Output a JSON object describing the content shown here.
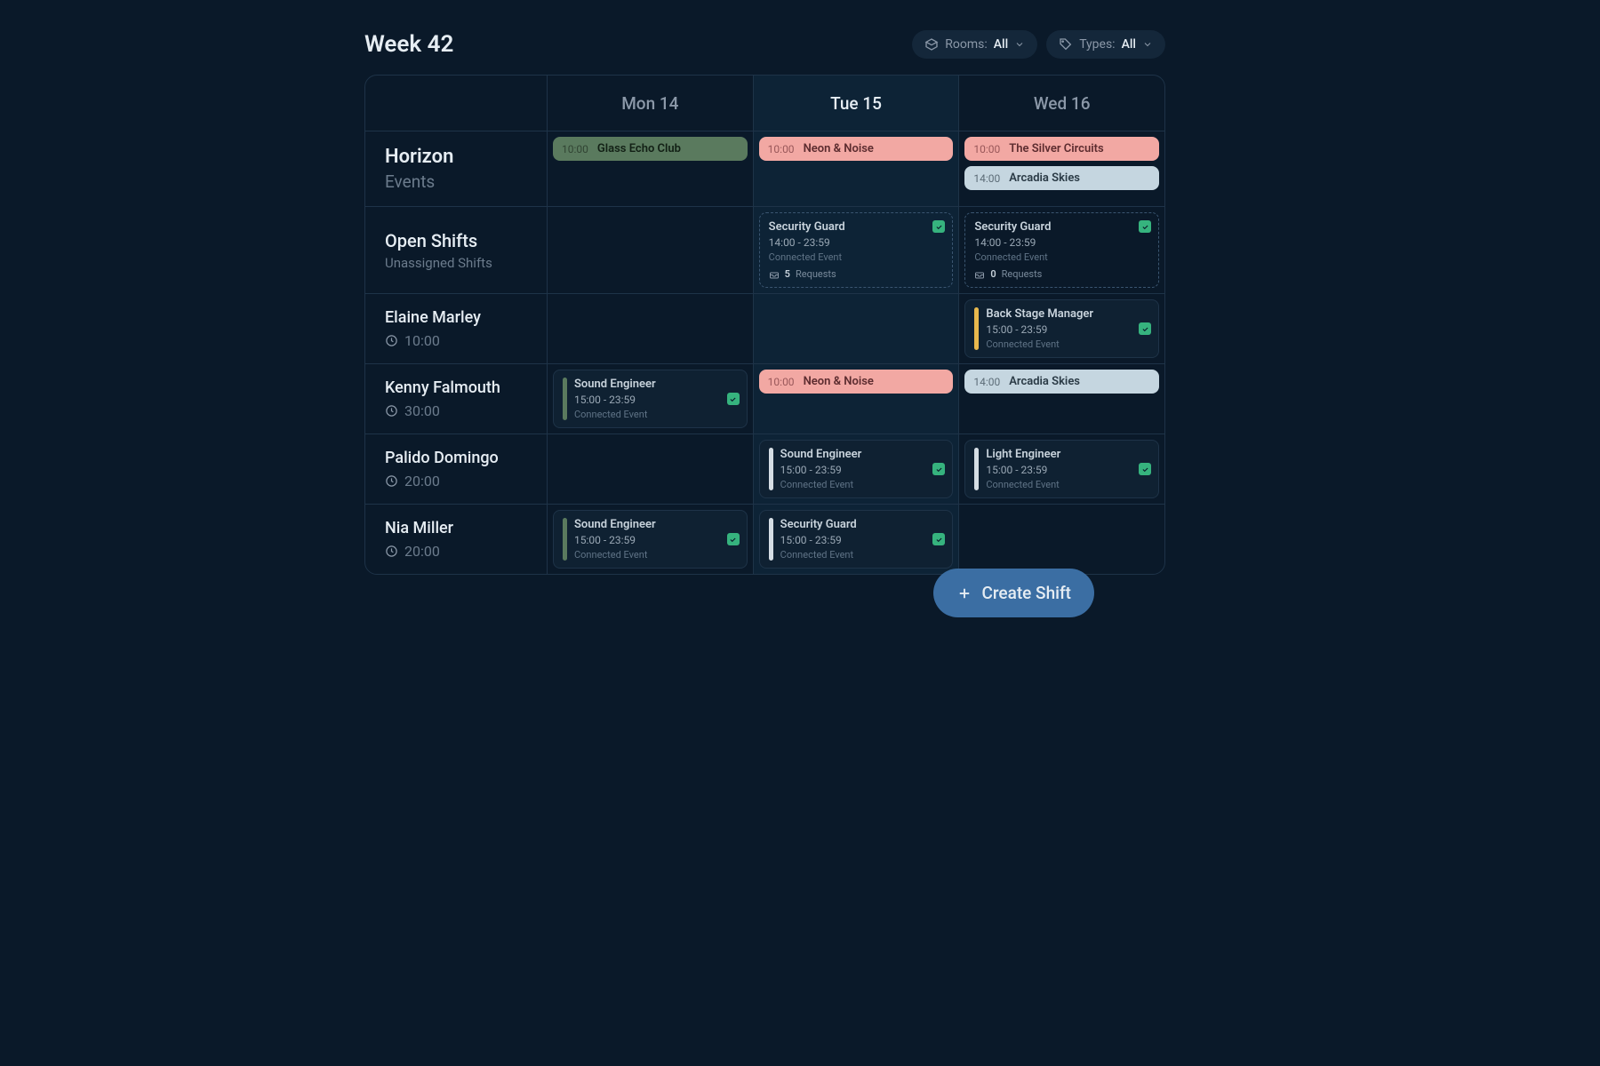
{
  "header": {
    "week_title": "Week 42",
    "rooms_label": "Rooms:",
    "rooms_value": "All",
    "types_label": "Types:",
    "types_value": "All"
  },
  "days": [
    {
      "label": "Mon 14",
      "active": false
    },
    {
      "label": "Tue 15",
      "active": true
    },
    {
      "label": "Wed 16",
      "active": false
    }
  ],
  "rows": [
    {
      "kind": "events",
      "name": "Horizon",
      "sub": "Events",
      "cells": [
        {
          "events": [
            {
              "time": "10:00",
              "name": "Glass Echo Club",
              "color": "green"
            }
          ]
        },
        {
          "events": [
            {
              "time": "10:00",
              "name": "Neon & Noise",
              "color": "pink"
            }
          ]
        },
        {
          "events": [
            {
              "time": "10:00",
              "name": "The Silver Circuits",
              "color": "pink"
            },
            {
              "time": "14:00",
              "name": "Arcadia Skies",
              "color": "blue"
            }
          ]
        }
      ]
    },
    {
      "kind": "open",
      "name": "Open Shifts",
      "sub": "Unassigned Shifts",
      "cells": [
        {
          "shifts": []
        },
        {
          "shifts": [
            {
              "title": "Security Guard",
              "time": "14:00 - 23:59",
              "sub": "Connected Event",
              "req_count": "5",
              "req_label": "Requests",
              "open": true
            }
          ]
        },
        {
          "shifts": [
            {
              "title": "Security Guard",
              "time": "14:00 - 23:59",
              "sub": "Connected Event",
              "req_count": "0",
              "req_label": "Requests",
              "open": true
            }
          ]
        }
      ]
    },
    {
      "kind": "person",
      "name": "Elaine Marley",
      "hours": "10:00",
      "cells": [
        {
          "shifts": []
        },
        {
          "shifts": []
        },
        {
          "shifts": [
            {
              "title": "Back Stage Manager",
              "time": "15:00 - 23:59",
              "sub": "Connected Event",
              "stripe": "yellow"
            }
          ]
        }
      ]
    },
    {
      "kind": "person",
      "name": "Kenny Falmouth",
      "hours": "30:00",
      "cells": [
        {
          "shifts": [
            {
              "title": "Sound Engineer",
              "time": "15:00 - 23:59",
              "sub": "Connected Event",
              "stripe": "green"
            }
          ]
        },
        {
          "events": [
            {
              "time": "10:00",
              "name": "Neon & Noise",
              "color": "pink"
            }
          ]
        },
        {
          "events": [
            {
              "time": "14:00",
              "name": "Arcadia Skies",
              "color": "blue"
            }
          ]
        }
      ]
    },
    {
      "kind": "person",
      "name": "Palido Domingo",
      "hours": "20:00",
      "cells": [
        {
          "shifts": []
        },
        {
          "shifts": [
            {
              "title": "Sound Engineer",
              "time": "15:00 - 23:59",
              "sub": "Connected Event",
              "stripe": "white"
            }
          ]
        },
        {
          "shifts": [
            {
              "title": "Light Engineer",
              "time": "15:00 - 23:59",
              "sub": "Connected Event",
              "stripe": "white"
            }
          ]
        }
      ]
    },
    {
      "kind": "person",
      "name": "Nia Miller",
      "hours": "20:00",
      "cells": [
        {
          "shifts": [
            {
              "title": "Sound Engineer",
              "time": "15:00 - 23:59",
              "sub": "Connected Event",
              "stripe": "green"
            }
          ]
        },
        {
          "shifts": [
            {
              "title": "Security Guard",
              "time": "15:00 - 23:59",
              "sub": "Connected Event",
              "stripe": "white"
            }
          ]
        },
        {
          "shifts": []
        }
      ]
    }
  ],
  "create_button": "Create Shift"
}
